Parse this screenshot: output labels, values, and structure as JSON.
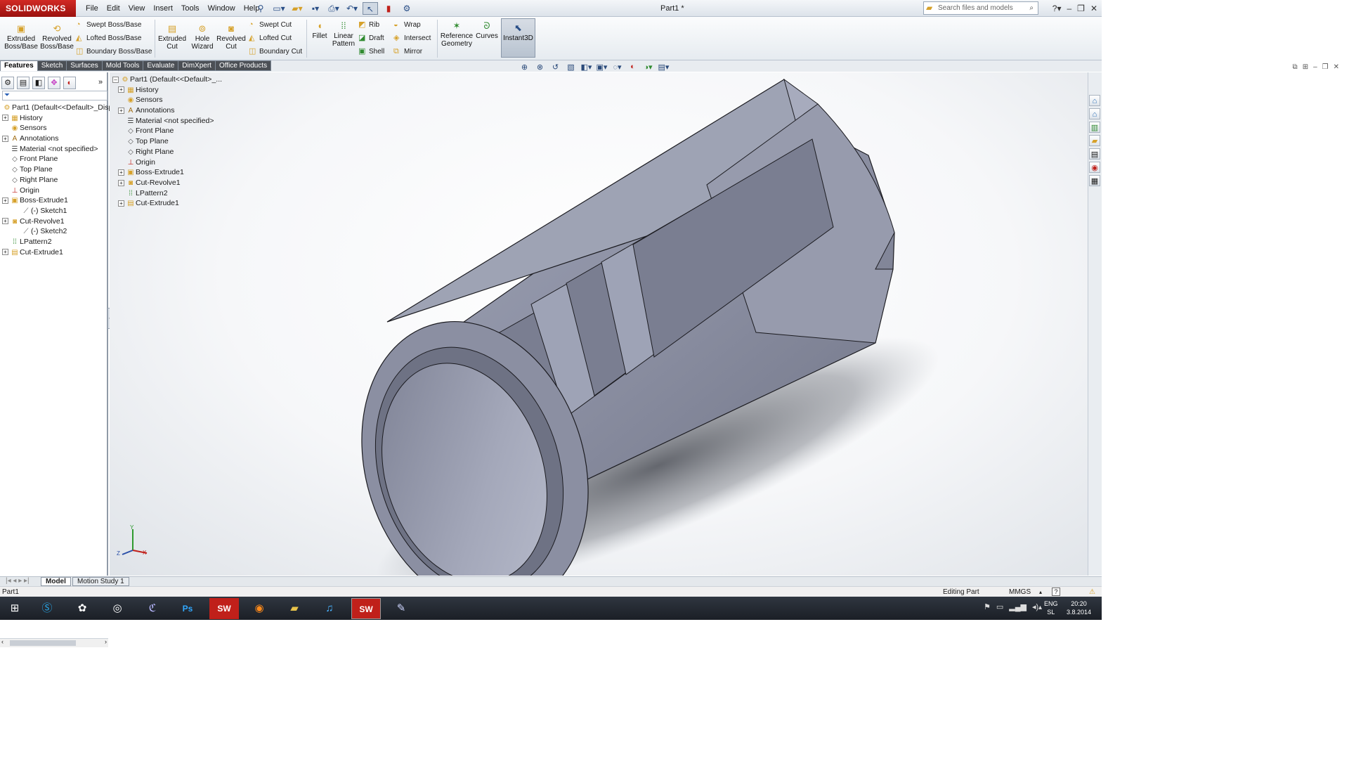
{
  "app": {
    "brand": "SOLIDWORKS",
    "document_title": "Part1 *"
  },
  "menu": [
    "File",
    "Edit",
    "View",
    "Insert",
    "Tools",
    "Window",
    "Help"
  ],
  "quick_access_icons": [
    "pin-icon",
    "new-icon",
    "open-icon",
    "save-icon",
    "print-icon",
    "undo-icon",
    "select-icon",
    "rebuild-icon",
    "options-icon"
  ],
  "search": {
    "placeholder": "Search files and models"
  },
  "ribbon": {
    "extruded_boss": "Extruded Boss/Base",
    "revolved_boss": "Revolved Boss/Base",
    "swept_boss": "Swept Boss/Base",
    "lofted_boss": "Lofted Boss/Base",
    "boundary_boss": "Boundary Boss/Base",
    "extruded_cut": "Extruded Cut",
    "hole_wizard": "Hole Wizard",
    "revolved_cut": "Revolved Cut",
    "swept_cut": "Swept Cut",
    "lofted_cut": "Lofted Cut",
    "boundary_cut": "Boundary Cut",
    "fillet": "Fillet",
    "linear_pattern": "Linear Pattern",
    "rib": "Rib",
    "draft": "Draft",
    "shell": "Shell",
    "wrap": "Wrap",
    "intersect": "Intersect",
    "mirror": "Mirror",
    "reference_geometry": "Reference Geometry",
    "curves": "Curves",
    "instant3d": "Instant3D"
  },
  "tabs": [
    "Features",
    "Sketch",
    "Surfaces",
    "Mold Tools",
    "Evaluate",
    "DimXpert",
    "Office Products"
  ],
  "feature_tree": {
    "root": "Part1  (Default<<Default>_Disp",
    "items": [
      {
        "label": "History",
        "expandable": true,
        "indent": 0,
        "icon": "history-icon"
      },
      {
        "label": "Sensors",
        "expandable": false,
        "indent": 0,
        "icon": "sensor-icon"
      },
      {
        "label": "Annotations",
        "expandable": true,
        "indent": 0,
        "icon": "annotation-icon"
      },
      {
        "label": "Material <not specified>",
        "expandable": false,
        "indent": 0,
        "icon": "material-icon"
      },
      {
        "label": "Front Plane",
        "expandable": false,
        "indent": 0,
        "icon": "plane-icon"
      },
      {
        "label": "Top Plane",
        "expandable": false,
        "indent": 0,
        "icon": "plane-icon"
      },
      {
        "label": "Right Plane",
        "expandable": false,
        "indent": 0,
        "icon": "plane-icon"
      },
      {
        "label": "Origin",
        "expandable": false,
        "indent": 0,
        "icon": "origin-icon"
      },
      {
        "label": "Boss-Extrude1",
        "expandable": true,
        "indent": 0,
        "icon": "extrude-icon"
      },
      {
        "label": "(-) Sketch1",
        "expandable": false,
        "indent": 1,
        "icon": "sketch-icon"
      },
      {
        "label": "Cut-Revolve1",
        "expandable": true,
        "indent": 0,
        "icon": "revolve-icon"
      },
      {
        "label": "(-) Sketch2",
        "expandable": false,
        "indent": 1,
        "icon": "sketch-icon"
      },
      {
        "label": "LPattern2",
        "expandable": false,
        "indent": 0,
        "icon": "pattern-icon"
      },
      {
        "label": "Cut-Extrude1",
        "expandable": true,
        "indent": 0,
        "icon": "cut-extrude-icon"
      }
    ]
  },
  "flyout_tree": {
    "root": "Part1  (Default<<Default>_...",
    "items": [
      {
        "label": "History",
        "expandable": true
      },
      {
        "label": "Sensors",
        "expandable": false
      },
      {
        "label": "Annotations",
        "expandable": true
      },
      {
        "label": "Material <not specified>",
        "expandable": false
      },
      {
        "label": "Front Plane",
        "expandable": false
      },
      {
        "label": "Top Plane",
        "expandable": false
      },
      {
        "label": "Right Plane",
        "expandable": false
      },
      {
        "label": "Origin",
        "expandable": false
      },
      {
        "label": "Boss-Extrude1",
        "expandable": true
      },
      {
        "label": "Cut-Revolve1",
        "expandable": true
      },
      {
        "label": "LPattern2",
        "expandable": false
      },
      {
        "label": "Cut-Extrude1",
        "expandable": true
      }
    ]
  },
  "bottom_tabs": [
    "Model",
    "Motion Study 1"
  ],
  "status": {
    "left": "Part1",
    "mode": "Editing Part",
    "units": "MMGS"
  },
  "triad": {
    "x": "X",
    "y": "Y",
    "z": "Z"
  },
  "tray": {
    "lang": "ENG",
    "layout": "SL",
    "time": "20:20",
    "date": "3.8.2014"
  },
  "colors": {
    "brand_red": "#c0201a",
    "part_gray": "#8e93a6",
    "tab_dark": "#4b4f55"
  }
}
